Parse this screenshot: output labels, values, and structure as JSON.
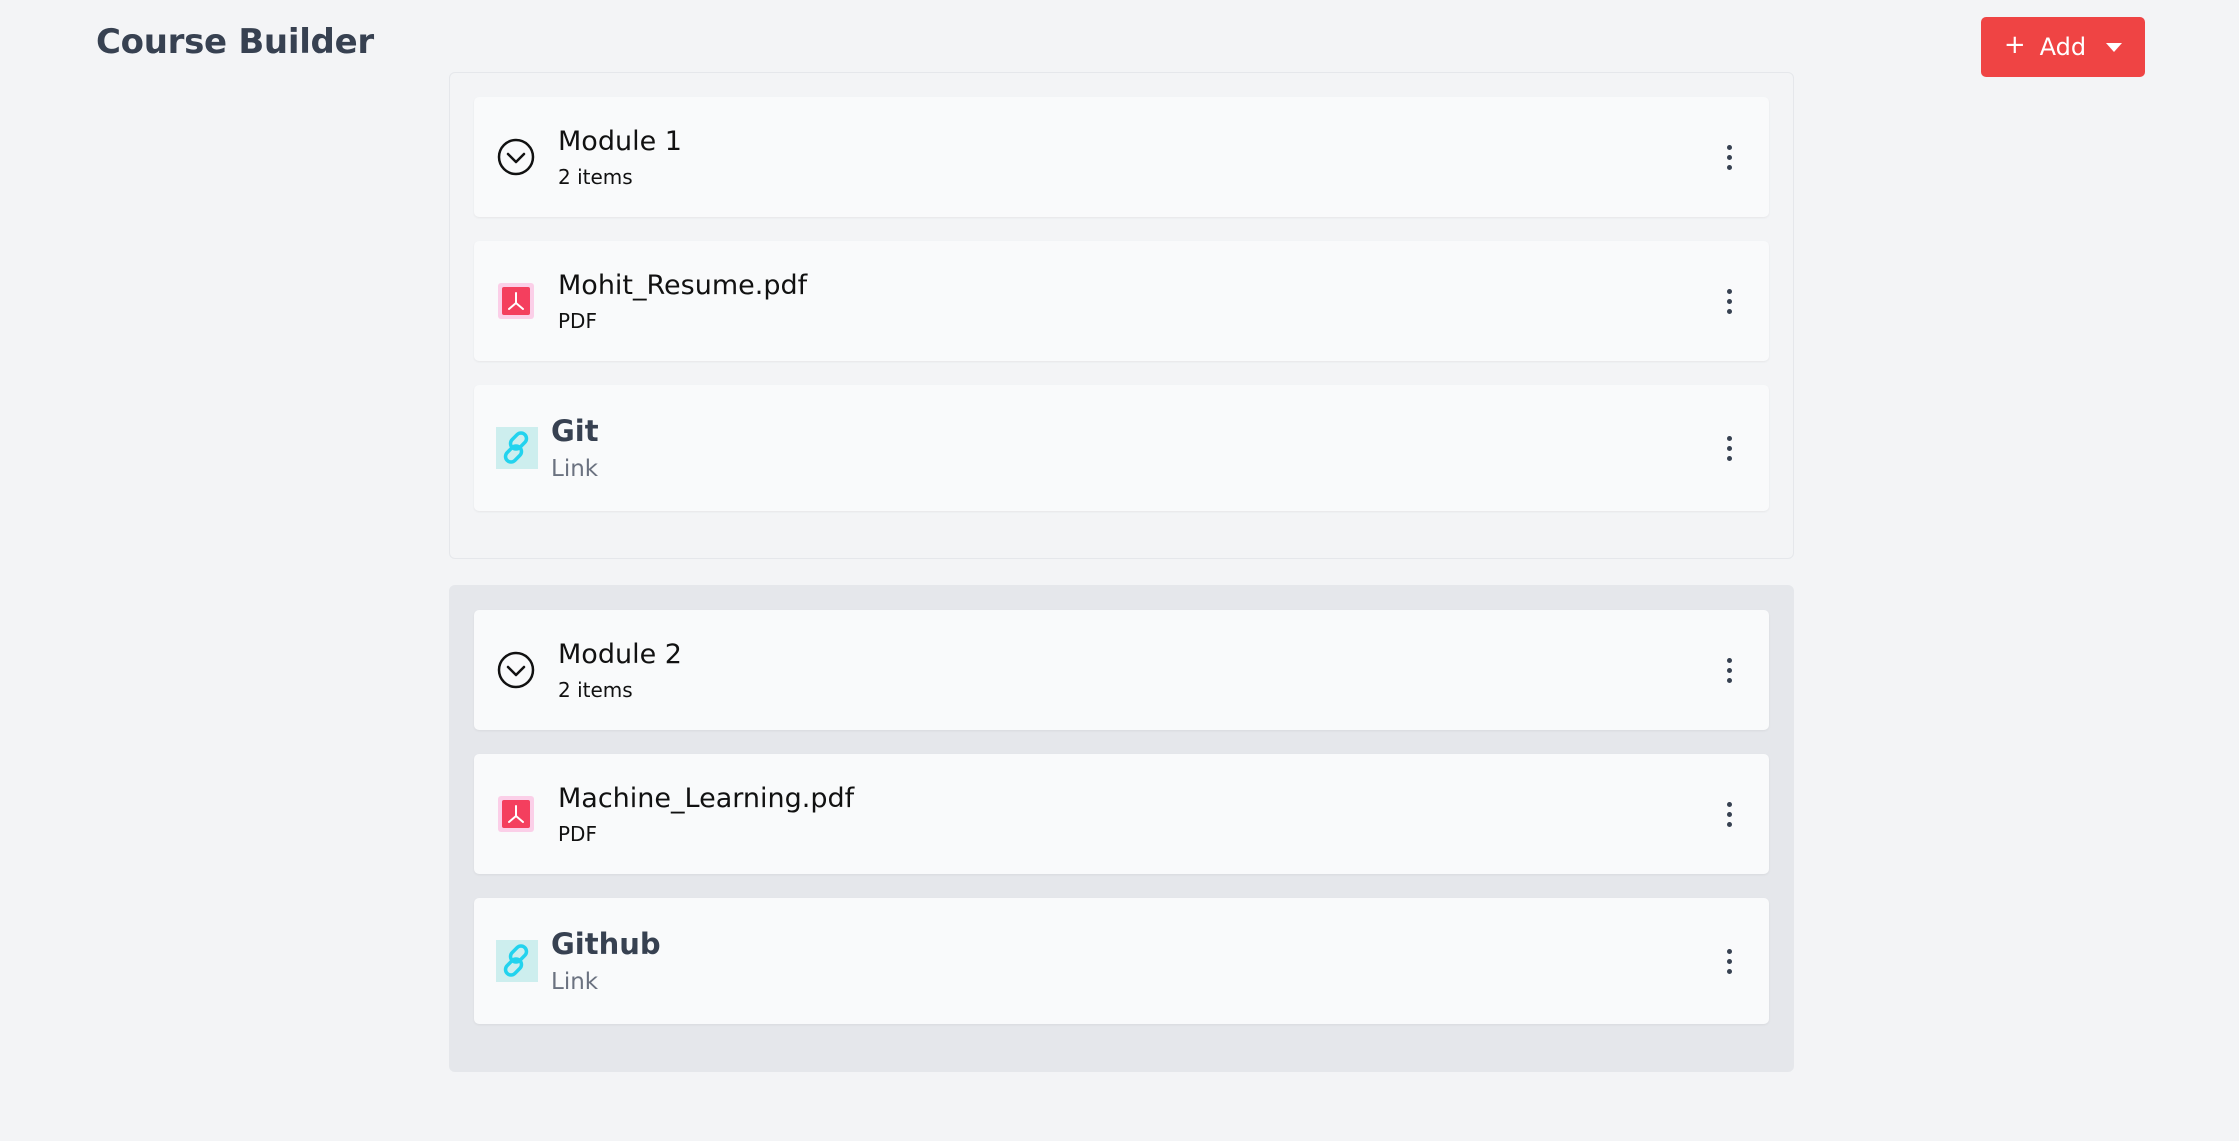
{
  "header": {
    "title": "Course Builder",
    "add_button": {
      "label": "Add",
      "icon": "plus-icon",
      "caret_icon": "caret-down-icon"
    }
  },
  "colors": {
    "accent": "#ef4444",
    "page_bg": "#f3f4f6",
    "card_bg": "#f9fafb",
    "pdf_icon": "#f43f5e",
    "link_icon": "#22d3ee"
  },
  "modules": [
    {
      "name": "Module 1",
      "count": "2 items",
      "items": [
        {
          "title": "Mohit_Resume.pdf",
          "type": "PDF",
          "icon": "pdf-icon"
        },
        {
          "title": "Git",
          "type": "Link",
          "icon": "link-icon"
        }
      ]
    },
    {
      "name": "Module 2",
      "count": "2 items",
      "items": [
        {
          "title": "Machine_Learning.pdf",
          "type": "PDF",
          "icon": "pdf-icon"
        },
        {
          "title": "Github",
          "type": "Link",
          "icon": "link-icon"
        }
      ]
    }
  ]
}
